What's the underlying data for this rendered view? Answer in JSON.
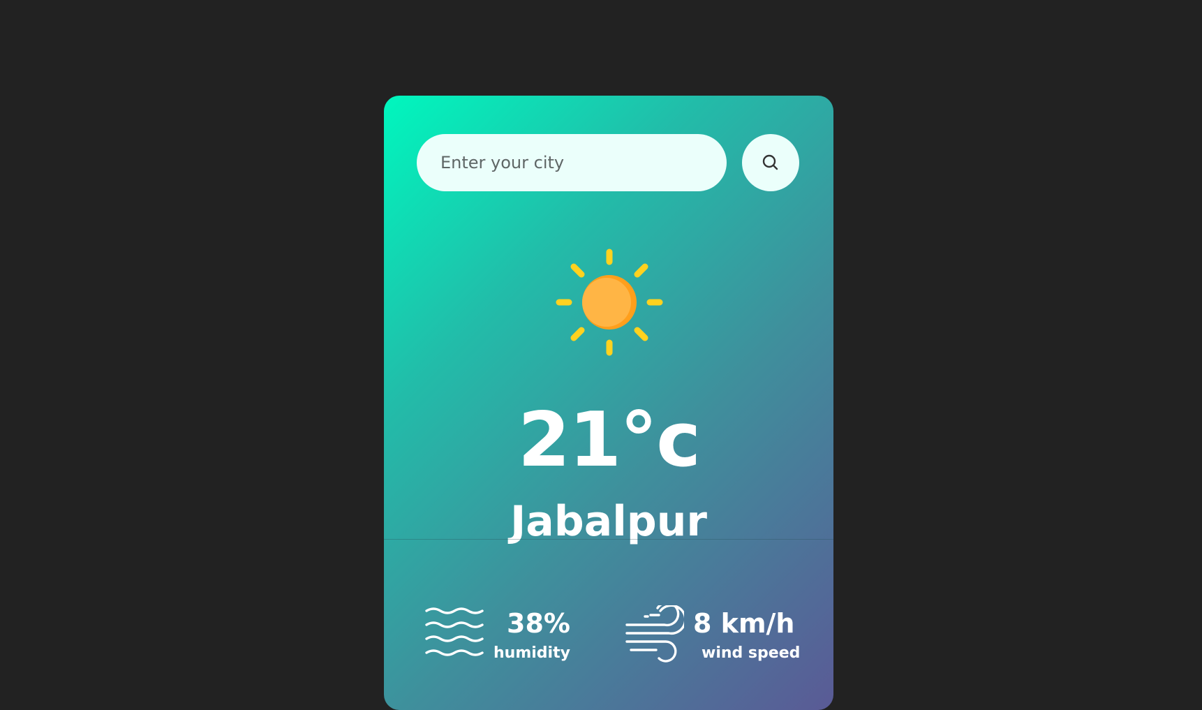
{
  "search": {
    "placeholder": "Enter your city",
    "button_icon": "search-icon"
  },
  "weather": {
    "icon": "sun-icon",
    "temperature": "21°c",
    "city": "Jabalpur"
  },
  "stats": {
    "humidity": {
      "icon": "humidity-waves-icon",
      "value": "38%",
      "label": "humidity"
    },
    "wind": {
      "icon": "wind-icon",
      "value": "8 km/h",
      "label": "wind speed"
    }
  },
  "colors": {
    "page_background": "#222222",
    "card_gradient_start": "#00f7be",
    "card_gradient_end": "#5a5a96",
    "input_background": "#ebfffb",
    "sun_rays": "#ffd21f",
    "sun_core": "#ffb03b"
  }
}
